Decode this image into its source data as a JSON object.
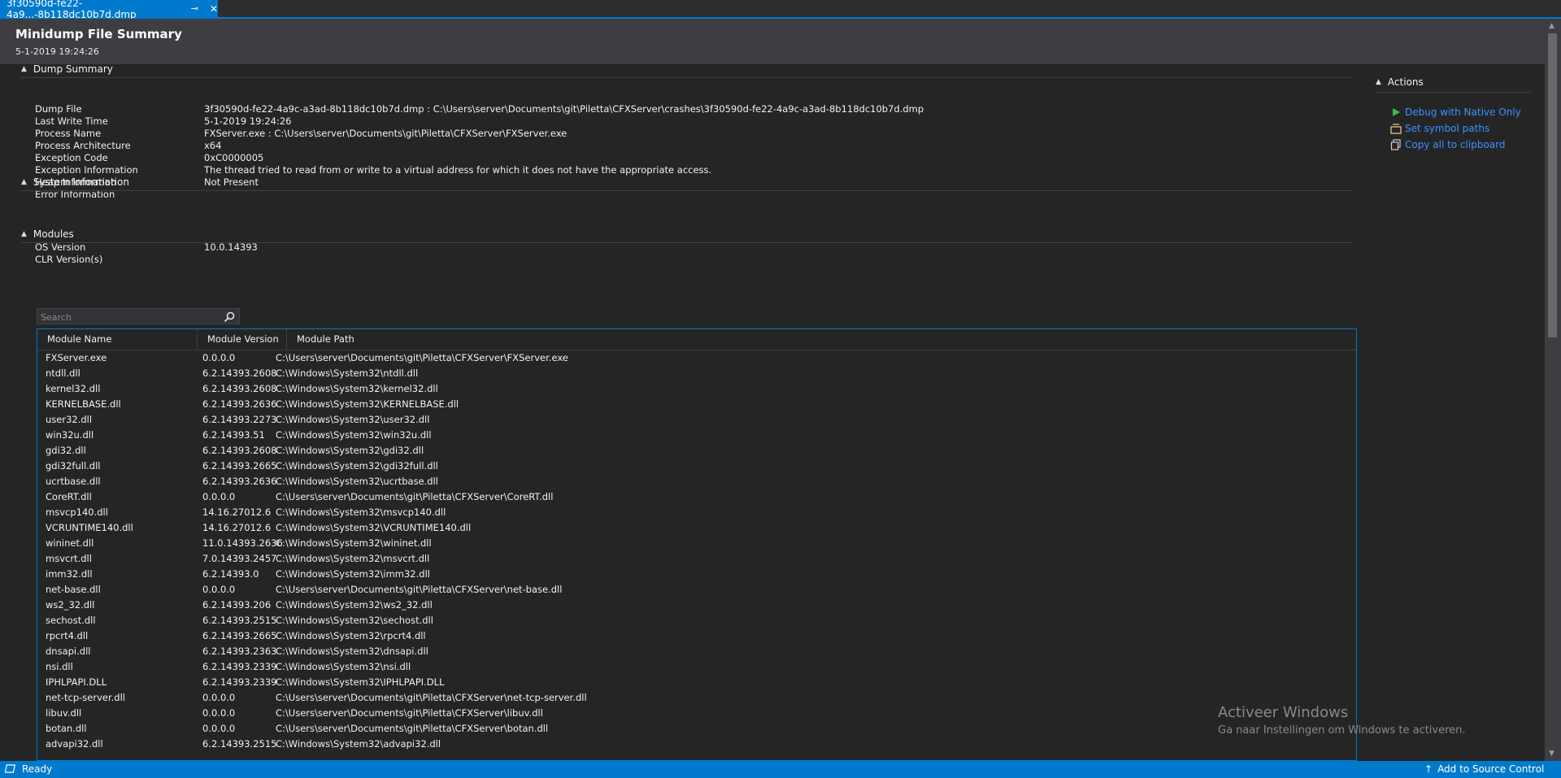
{
  "tab": {
    "title": "3f30590d-fe22-4a9...-8b118dc10b7d.dmp",
    "pin_glyph": "⊸",
    "close_glyph": "✕"
  },
  "header": {
    "title": "Minidump File Summary",
    "date": "5-1-2019 19:24:26"
  },
  "dump_summary": {
    "heading": "Dump Summary",
    "fields": [
      {
        "label": "Dump File",
        "value": "3f30590d-fe22-4a9c-a3ad-8b118dc10b7d.dmp : C:\\Users\\server\\Documents\\git\\Piletta\\CFXServer\\crashes\\3f30590d-fe22-4a9c-a3ad-8b118dc10b7d.dmp"
      },
      {
        "label": "Last Write Time",
        "value": "5-1-2019 19:24:26"
      },
      {
        "label": "Process Name",
        "value": "FXServer.exe : C:\\Users\\server\\Documents\\git\\Piletta\\CFXServer\\FXServer.exe"
      },
      {
        "label": "Process Architecture",
        "value": "x64"
      },
      {
        "label": "Exception Code",
        "value": "0xC0000005"
      },
      {
        "label": "Exception Information",
        "value": "The thread tried to read from or write to a virtual address for which it does not have the appropriate access."
      },
      {
        "label": "Heap Information",
        "value": "Not Present"
      },
      {
        "label": "Error Information",
        "value": ""
      }
    ]
  },
  "system_info": {
    "heading": "System Information",
    "fields": [
      {
        "label": "OS Version",
        "value": "10.0.14393"
      },
      {
        "label": "CLR Version(s)",
        "value": ""
      }
    ]
  },
  "modules": {
    "heading": "Modules",
    "search_placeholder": "Search",
    "columns": [
      "Module Name",
      "Module Version",
      "Module Path"
    ],
    "rows": [
      [
        "FXServer.exe",
        "0.0.0.0",
        "C:\\Users\\server\\Documents\\git\\Piletta\\CFXServer\\FXServer.exe"
      ],
      [
        "ntdll.dll",
        "6.2.14393.2608",
        "C:\\Windows\\System32\\ntdll.dll"
      ],
      [
        "kernel32.dll",
        "6.2.14393.2608",
        "C:\\Windows\\System32\\kernel32.dll"
      ],
      [
        "KERNELBASE.dll",
        "6.2.14393.2636",
        "C:\\Windows\\System32\\KERNELBASE.dll"
      ],
      [
        "user32.dll",
        "6.2.14393.2273",
        "C:\\Windows\\System32\\user32.dll"
      ],
      [
        "win32u.dll",
        "6.2.14393.51",
        "C:\\Windows\\System32\\win32u.dll"
      ],
      [
        "gdi32.dll",
        "6.2.14393.2608",
        "C:\\Windows\\System32\\gdi32.dll"
      ],
      [
        "gdi32full.dll",
        "6.2.14393.2665",
        "C:\\Windows\\System32\\gdi32full.dll"
      ],
      [
        "ucrtbase.dll",
        "6.2.14393.2636",
        "C:\\Windows\\System32\\ucrtbase.dll"
      ],
      [
        "CoreRT.dll",
        "0.0.0.0",
        "C:\\Users\\server\\Documents\\git\\Piletta\\CFXServer\\CoreRT.dll"
      ],
      [
        "msvcp140.dll",
        "14.16.27012.6",
        "C:\\Windows\\System32\\msvcp140.dll"
      ],
      [
        "VCRUNTIME140.dll",
        "14.16.27012.6",
        "C:\\Windows\\System32\\VCRUNTIME140.dll"
      ],
      [
        "wininet.dll",
        "11.0.14393.2636",
        "C:\\Windows\\System32\\wininet.dll"
      ],
      [
        "msvcrt.dll",
        "7.0.14393.2457",
        "C:\\Windows\\System32\\msvcrt.dll"
      ],
      [
        "imm32.dll",
        "6.2.14393.0",
        "C:\\Windows\\System32\\imm32.dll"
      ],
      [
        "net-base.dll",
        "0.0.0.0",
        "C:\\Users\\server\\Documents\\git\\Piletta\\CFXServer\\net-base.dll"
      ],
      [
        "ws2_32.dll",
        "6.2.14393.206",
        "C:\\Windows\\System32\\ws2_32.dll"
      ],
      [
        "sechost.dll",
        "6.2.14393.2515",
        "C:\\Windows\\System32\\sechost.dll"
      ],
      [
        "rpcrt4.dll",
        "6.2.14393.2665",
        "C:\\Windows\\System32\\rpcrt4.dll"
      ],
      [
        "dnsapi.dll",
        "6.2.14393.2363",
        "C:\\Windows\\System32\\dnsapi.dll"
      ],
      [
        "nsi.dll",
        "6.2.14393.2339",
        "C:\\Windows\\System32\\nsi.dll"
      ],
      [
        "IPHLPAPI.DLL",
        "6.2.14393.2339",
        "C:\\Windows\\System32\\IPHLPAPI.DLL"
      ],
      [
        "net-tcp-server.dll",
        "0.0.0.0",
        "C:\\Users\\server\\Documents\\git\\Piletta\\CFXServer\\net-tcp-server.dll"
      ],
      [
        "libuv.dll",
        "0.0.0.0",
        "C:\\Users\\server\\Documents\\git\\Piletta\\CFXServer\\libuv.dll"
      ],
      [
        "botan.dll",
        "0.0.0.0",
        "C:\\Users\\server\\Documents\\git\\Piletta\\CFXServer\\botan.dll"
      ],
      [
        "advapi32.dll",
        "6.2.14393.2515",
        "C:\\Windows\\System32\\advapi32.dll"
      ]
    ]
  },
  "actions": {
    "heading": "Actions",
    "items": [
      {
        "label": "Debug with Native Only",
        "icon": "play-icon"
      },
      {
        "label": "Set symbol paths",
        "icon": "symbol-paths-icon"
      },
      {
        "label": "Copy all to clipboard",
        "icon": "copy-icon"
      }
    ]
  },
  "status": {
    "ready": "Ready",
    "source_control": "Add to Source Control"
  },
  "watermark": {
    "line1": "Activeer Windows",
    "line2": "Ga naar Instellingen om Windows te activeren."
  },
  "colors": {
    "accent": "#007acc",
    "link": "#3794ff",
    "background": "#252526",
    "header": "#3e3e42"
  }
}
